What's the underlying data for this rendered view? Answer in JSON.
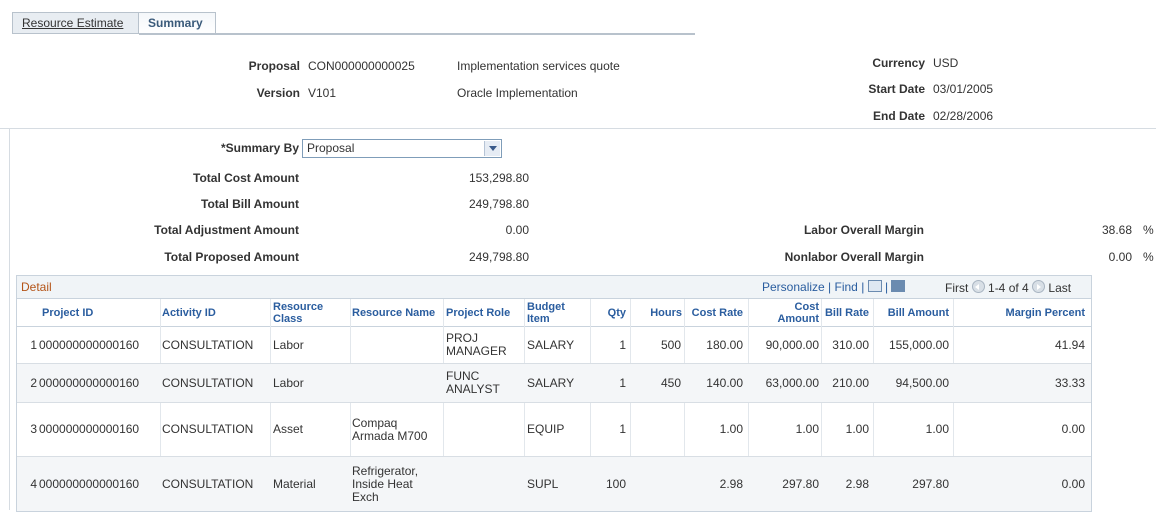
{
  "tabs": [
    {
      "label": "Resource Estimate",
      "active": false
    },
    {
      "label": "Summary",
      "active": true
    }
  ],
  "header": {
    "proposal_label": "Proposal",
    "proposal_value": "CON000000000025",
    "proposal_desc": "Implementation services quote",
    "version_label": "Version",
    "version_value": "V101",
    "version_desc": "Oracle Implementation",
    "currency_label": "Currency",
    "currency_value": "USD",
    "start_label": "Start Date",
    "start_value": "03/01/2005",
    "end_label": "End Date",
    "end_value": "02/28/2006"
  },
  "summary": {
    "summary_by_label": "*Summary By",
    "summary_by_value": "Proposal",
    "total_cost_label": "Total Cost Amount",
    "total_cost_value": "153,298.80",
    "total_bill_label": "Total Bill Amount",
    "total_bill_value": "249,798.80",
    "total_adj_label": "Total Adjustment Amount",
    "total_adj_value": "0.00",
    "total_prop_label": "Total Proposed Amount",
    "total_prop_value": "249,798.80",
    "labor_margin_label": "Labor Overall Margin",
    "labor_margin_value": "38.68",
    "labor_margin_unit": "%",
    "nonlabor_margin_label": "Nonlabor Overall Margin",
    "nonlabor_margin_value": "0.00",
    "nonlabor_margin_unit": "%"
  },
  "grid": {
    "title": "Detail",
    "personalize": "Personalize",
    "sep1": "|",
    "find": "Find",
    "sep2": "|",
    "sep3": "|",
    "first": "First",
    "range": "1-4 of 4",
    "last": "Last",
    "columns": [
      "Project ID",
      "Activity ID",
      "Resource Class",
      "Resource Name",
      "Project Role",
      "Budget Item",
      "Qty",
      "Hours",
      "Cost Rate",
      "Cost Amount",
      "Bill Rate",
      "Bill Amount",
      "Margin Percent"
    ],
    "rows": [
      {
        "num": "1",
        "project_id": "000000000000160",
        "activity_id": "CONSULTATION",
        "resource_class": "Labor",
        "resource_name": "",
        "project_role": "PROJ MANAGER",
        "budget_item": "SALARY",
        "qty": "1",
        "hours": "500",
        "cost_rate": "180.00",
        "cost_amount": "90,000.00",
        "bill_rate": "310.00",
        "bill_amount": "155,000.00",
        "margin": "41.94"
      },
      {
        "num": "2",
        "project_id": "000000000000160",
        "activity_id": "CONSULTATION",
        "resource_class": "Labor",
        "resource_name": "",
        "project_role": "FUNC ANALYST",
        "budget_item": "SALARY",
        "qty": "1",
        "hours": "450",
        "cost_rate": "140.00",
        "cost_amount": "63,000.00",
        "bill_rate": "210.00",
        "bill_amount": "94,500.00",
        "margin": "33.33"
      },
      {
        "num": "3",
        "project_id": "000000000000160",
        "activity_id": "CONSULTATION",
        "resource_class": "Asset",
        "resource_name": "Compaq Armada M700",
        "project_role": "",
        "budget_item": "EQUIP",
        "qty": "1",
        "hours": "",
        "cost_rate": "1.00",
        "cost_amount": "1.00",
        "bill_rate": "1.00",
        "bill_amount": "1.00",
        "margin": "0.00"
      },
      {
        "num": "4",
        "project_id": "000000000000160",
        "activity_id": "CONSULTATION",
        "resource_class": "Material",
        "resource_name": "Refrigerator, Inside Heat Exch",
        "project_role": "",
        "budget_item": "SUPL",
        "qty": "100",
        "hours": "",
        "cost_rate": "2.98",
        "cost_amount": "297.80",
        "bill_rate": "2.98",
        "bill_amount": "297.80",
        "margin": "0.00"
      }
    ]
  }
}
